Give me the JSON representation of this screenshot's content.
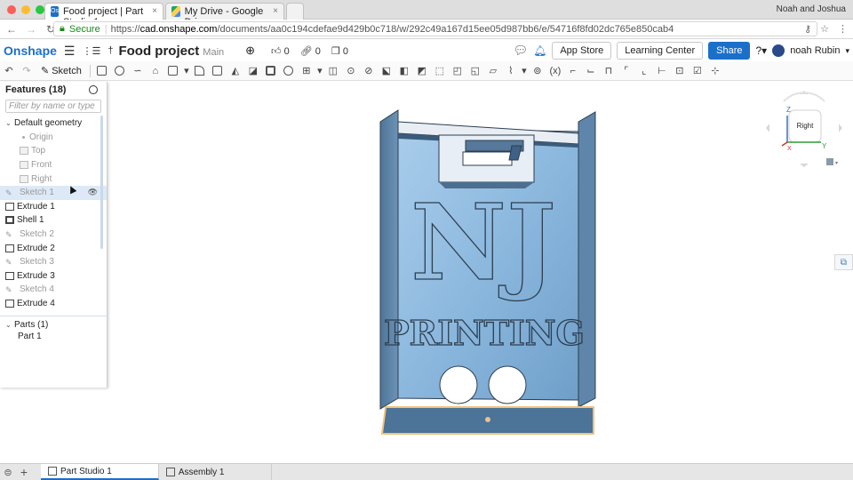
{
  "browser": {
    "tabs": [
      {
        "title": "Food project | Part Studio 1",
        "favicon": "Os"
      },
      {
        "title": "My Drive - Google Drive"
      }
    ],
    "user": "Noah and Joshua",
    "address": {
      "secure_label": "Secure",
      "scheme": "https://",
      "host": "cad.onshape.com",
      "path": "/documents/aa0c194cdefae9d429b0c718/w/292c49a167d15ee05d987bb6/e/54716f8fd02dc765e850cab4"
    }
  },
  "onshape": {
    "logo": "Onshape",
    "document_name": "Food project",
    "branch": "Main",
    "counts": {
      "likes": "0",
      "links": "0",
      "copies": "0"
    },
    "app_store": "App Store",
    "learning_center": "Learning Center",
    "share": "Share",
    "user_name": "noah Rubin"
  },
  "toolbar": {
    "sketch_label": "Sketch"
  },
  "features": {
    "header": "Features (18)",
    "filter_placeholder": "Filter by name or type",
    "default_geometry": "Default geometry",
    "geometry": [
      "Origin",
      "Top",
      "Front",
      "Right"
    ],
    "items": [
      {
        "label": "Sketch 1",
        "kind": "sketch"
      },
      {
        "label": "Extrude 1",
        "kind": "feature"
      },
      {
        "label": "Shell 1",
        "kind": "feature"
      },
      {
        "label": "Sketch 2",
        "kind": "sketch"
      },
      {
        "label": "Extrude 2",
        "kind": "feature"
      },
      {
        "label": "Sketch 3",
        "kind": "sketch"
      },
      {
        "label": "Extrude 3",
        "kind": "feature"
      },
      {
        "label": "Sketch 4",
        "kind": "sketch"
      },
      {
        "label": "Extrude 4",
        "kind": "feature"
      }
    ],
    "parts_header": "Parts (1)",
    "parts": [
      "Part 1"
    ]
  },
  "model": {
    "text_top": "NJ",
    "text_bottom": "PRINTING",
    "colors": {
      "body": "#8ab6dc",
      "edge": "#f2c27a",
      "dark": "#4a6e8e"
    }
  },
  "viewcube": {
    "face": "Right",
    "axis_z": "Z",
    "axis_y": "Y",
    "axis_x": "X"
  },
  "bottom_tabs": {
    "part_studio": "Part Studio 1",
    "assembly": "Assembly 1"
  }
}
